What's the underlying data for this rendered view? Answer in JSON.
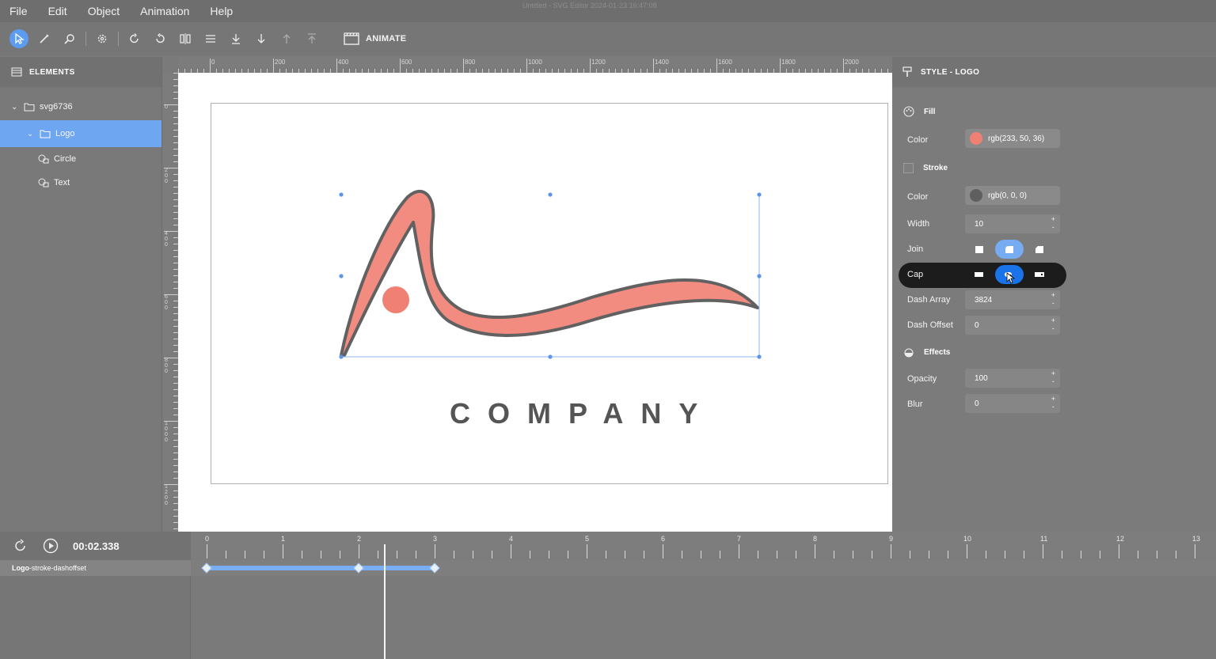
{
  "window_title": "Untitled - SVG Editor 2024-01-23 16:47:08",
  "menu": [
    "File",
    "Edit",
    "Object",
    "Animation",
    "Help"
  ],
  "toolbar": {
    "tools": [
      "select-tool",
      "pen-tool",
      "zoom-tool",
      "settings-tool",
      "rotate-left-tool",
      "rotate-right-tool",
      "flip-horizontal-tool",
      "align-tool",
      "move-down-tool",
      "move-bottom-tool",
      "move-up-tool",
      "move-top-tool"
    ],
    "animate_label": "ANIMATE"
  },
  "elements_panel": {
    "title": "ELEMENTS",
    "tree": [
      {
        "label": "svg6736",
        "level": 0,
        "icon": "folder-icon"
      },
      {
        "label": "Logo",
        "level": 1,
        "icon": "folder-icon",
        "selected": true
      },
      {
        "label": "Circle",
        "level": 2,
        "icon": "shape-icon"
      },
      {
        "label": "Text",
        "level": 2,
        "icon": "shape-icon"
      }
    ]
  },
  "ruler": {
    "top": [
      "0",
      "200",
      "400",
      "600",
      "800",
      "1000",
      "1200",
      "1400",
      "1600",
      "1800",
      "2000"
    ],
    "left": [
      "0",
      "200",
      "400",
      "600",
      "800",
      "1000",
      "1200"
    ]
  },
  "canvas": {
    "logo_text": "COMPANY",
    "fill_color": "#f28b80",
    "stroke_color": "#616161"
  },
  "style_panel": {
    "title": "STYLE - LOGO",
    "fill": {
      "section": "Fill",
      "color_label": "Color",
      "color_value": "rgb(233, 50, 36)",
      "swatch": "#f28b80"
    },
    "stroke": {
      "section": "Stroke",
      "color_label": "Color",
      "color_value": "rgb(0, 0, 0)",
      "swatch": "#5f5f5f",
      "width_label": "Width",
      "width_value": "10",
      "join_label": "Join",
      "cap_label": "Cap",
      "dash_array_label": "Dash Array",
      "dash_array_value": "3824",
      "dash_offset_label": "Dash Offset",
      "dash_offset_value": "0"
    },
    "effects": {
      "section": "Effects",
      "opacity_label": "Opacity",
      "opacity_value": "100",
      "blur_label": "Blur",
      "blur_value": "0"
    }
  },
  "timeline": {
    "time": "00:02.338",
    "ticks": [
      "0",
      "1",
      "2",
      "3",
      "4",
      "5",
      "6",
      "7",
      "8",
      "9",
      "10",
      "11",
      "12",
      "13"
    ],
    "track_name_bold": "Logo",
    "track_name_rest": "-stroke-dashoffset",
    "keyframes_seconds": [
      0,
      2,
      3
    ],
    "accent": "#7aaef2"
  }
}
